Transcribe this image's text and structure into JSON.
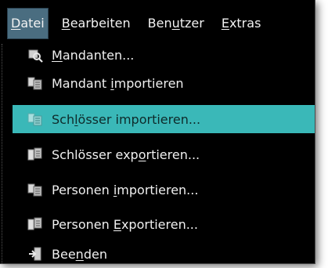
{
  "menubar": {
    "items": [
      {
        "label": "Datei",
        "mnemonic": "D",
        "active": true
      },
      {
        "label": "Bearbeiten",
        "mnemonic": "B"
      },
      {
        "label": "Benutzer",
        "mnemonic": "u"
      },
      {
        "label": "Extras",
        "mnemonic": "E"
      }
    ]
  },
  "menu": {
    "items": [
      {
        "label": "Mandanten...",
        "icon": "search-db-icon"
      },
      {
        "label": "Mandant importieren",
        "icon": "import-icon"
      },
      {
        "label": "Schlösser importieren...",
        "icon": "import-icon",
        "highlighted": true
      },
      {
        "label": "Schlösser exportieren...",
        "icon": "export-icon"
      },
      {
        "label": "Personen importieren...",
        "icon": "import-icon"
      },
      {
        "label": "Personen Exportieren...",
        "icon": "export-icon"
      },
      {
        "label": "Beenden",
        "icon": "exit-icon"
      }
    ]
  },
  "colors": {
    "menubar_active_bg": "#4a6d80",
    "highlight_bg": "#3ab8b8",
    "background": "#000000"
  }
}
